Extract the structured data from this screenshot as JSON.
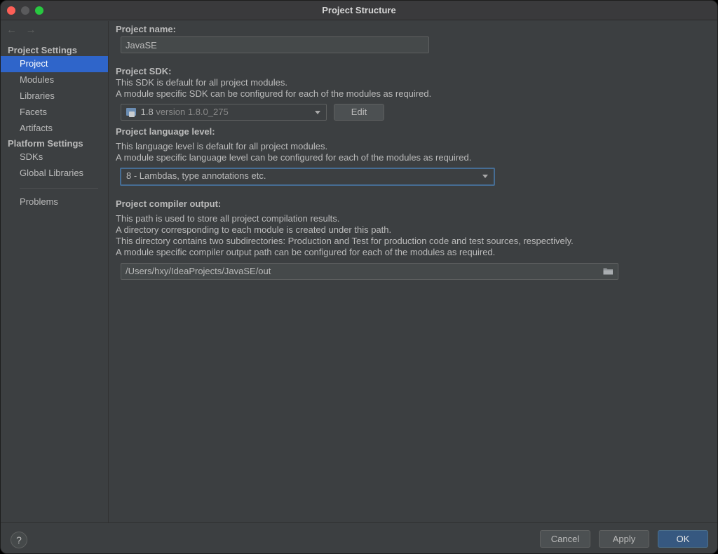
{
  "window": {
    "title": "Project Structure"
  },
  "sidebar": {
    "nav": {
      "back": "←",
      "forward": "→"
    },
    "project_settings_title": "Project Settings",
    "project_items": [
      {
        "label": "Project",
        "selected": true
      },
      {
        "label": "Modules"
      },
      {
        "label": "Libraries"
      },
      {
        "label": "Facets"
      },
      {
        "label": "Artifacts"
      }
    ],
    "platform_settings_title": "Platform Settings",
    "platform_items": [
      {
        "label": "SDKs"
      },
      {
        "label": "Global Libraries"
      }
    ],
    "problems_label": "Problems"
  },
  "main": {
    "project_name": {
      "label": "Project name:",
      "value": "JavaSE"
    },
    "project_sdk": {
      "label": "Project SDK:",
      "desc_1": "This SDK is default for all project modules.",
      "desc_2": "A module specific SDK can be configured for each of the modules as required.",
      "selected_name": "1.8",
      "selected_version": "version 1.8.0_275",
      "edit_button": "Edit"
    },
    "language_level": {
      "label": "Project language level:",
      "desc_1": "This language level is default for all project modules.",
      "desc_2": "A module specific language level can be configured for each of the modules as required.",
      "selected": "8 - Lambdas, type annotations etc."
    },
    "compiler_output": {
      "label": "Project compiler output:",
      "desc_1": "This path is used to store all project compilation results.",
      "desc_2": "A directory corresponding to each module is created under this path.",
      "desc_3": "This directory contains two subdirectories: Production and Test for production code and test sources, respectively.",
      "desc_4": "A module specific compiler output path can be configured for each of the modules as required.",
      "path": "/Users/hxy/IdeaProjects/JavaSE/out"
    }
  },
  "footer": {
    "help": "?",
    "cancel": "Cancel",
    "apply": "Apply",
    "ok": "OK"
  },
  "colors": {
    "background": "#3c3f41",
    "selection": "#2f65ca",
    "primary_button": "#365880",
    "focus_border": "#466d94"
  }
}
